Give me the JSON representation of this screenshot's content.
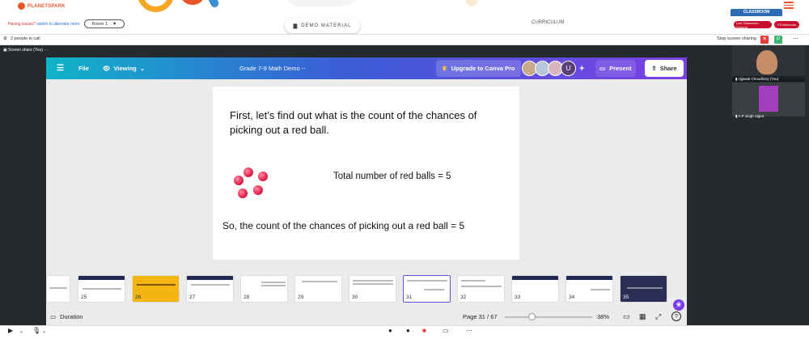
{
  "header": {
    "logo_text": "PLANETSPARK",
    "issues_text": "Having issues?",
    "switch_link": "switch to alternate room",
    "room_label": "Room 1",
    "demo_label": "DEMO MATERIAL",
    "curriculum_label": "CURRICULUM",
    "classroom_label": "CLASSROOM",
    "support_label": "Live Classroom Support",
    "ps_label": "PS Moments"
  },
  "callbar": {
    "people": "2 people in call",
    "stop_share": "Stop screen sharing",
    "p_badge": "P"
  },
  "screen_share_label": "Screen share (You)",
  "canva": {
    "file": "File",
    "viewing": "Viewing",
    "doc_title": "Grade 7-9 Math Demo --",
    "upgrade": "Upgrade to Canva Pro",
    "avatar_u": "U",
    "present": "Present",
    "share": "Share",
    "duration": "Duration",
    "page": "Page 31 / 67",
    "zoom": "38%",
    "help": "?",
    "zoom_fraction": 0.38
  },
  "slide": {
    "line1": "First, let’s find out what is the count of the chances of picking out a red ball.",
    "line2": "Total number of red balls = 5",
    "line3": "So, the count of the chances of picking out a red ball = 5",
    "ball_color": "#e0234a"
  },
  "thumbnails": [
    "25",
    "26",
    "27",
    "28",
    "29",
    "30",
    "31",
    "32",
    "33",
    "34",
    "35"
  ],
  "thumbnail_selected": "31",
  "participants": [
    {
      "name": "Ujjawal Choudhary (You)"
    },
    {
      "name": "A.P singh rajput"
    }
  ],
  "colors": {
    "accent": "#7b3fe4",
    "brand": "#e8572a",
    "alert": "#c8102e"
  }
}
